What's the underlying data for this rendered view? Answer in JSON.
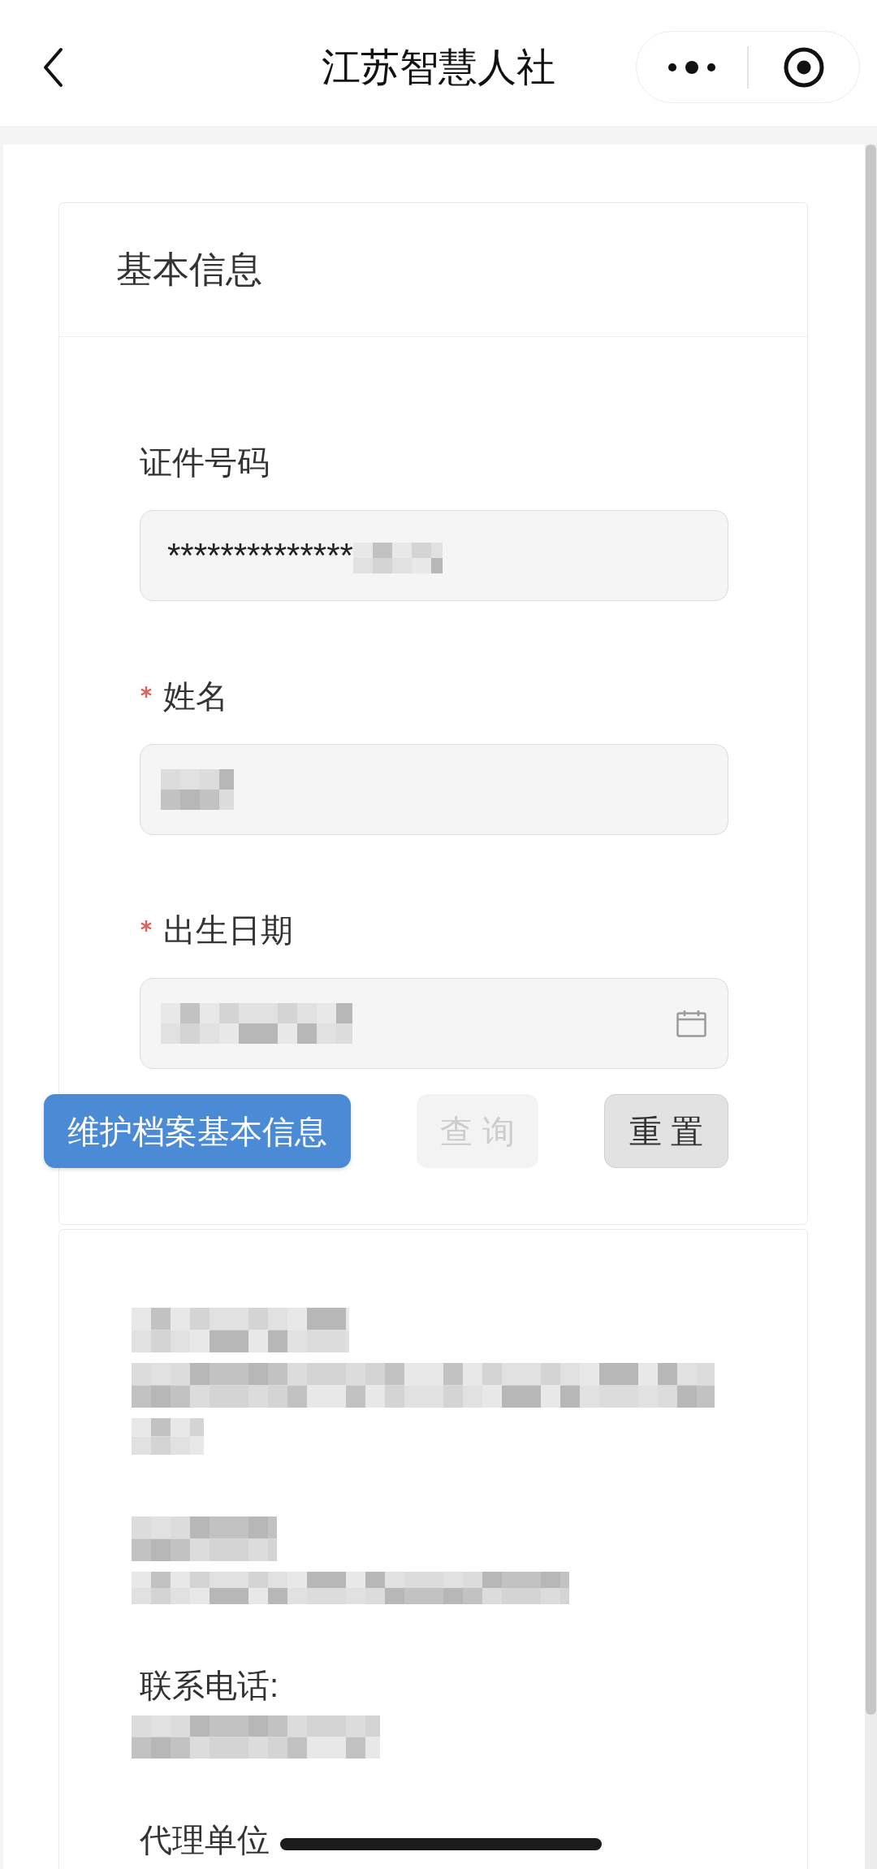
{
  "nav_bar": {
    "title": "江苏智慧人社"
  },
  "form_card": {
    "title": "基本信息",
    "fields": [
      {
        "kind": "text",
        "label": "证件号码",
        "required": false,
        "value": "**************",
        "value_redacted": true
      },
      {
        "kind": "text",
        "label": "姓名",
        "required": true,
        "value_redacted": true
      },
      {
        "kind": "date",
        "label": "出生日期",
        "required": true,
        "value_redacted": true
      }
    ],
    "buttons": [
      {
        "kind": "primary",
        "label": "维护档案基本信息",
        "disabled": false
      },
      {
        "kind": "secondary",
        "label": "查 询",
        "disabled": true
      },
      {
        "kind": "secondary",
        "label": "重 置",
        "disabled": false
      }
    ]
  },
  "details_card": {
    "entries": [
      {
        "lines": [
          {
            "kind": "redacted"
          },
          {
            "kind": "redacted"
          },
          {
            "kind": "redacted"
          }
        ]
      },
      {
        "lines": [
          {
            "kind": "redacted"
          },
          {
            "kind": "redacted"
          }
        ]
      },
      {
        "lines": [
          {
            "kind": "label",
            "label": "联系电话:"
          },
          {
            "kind": "redacted"
          }
        ]
      },
      {
        "lines": [
          {
            "kind": "label",
            "label": "代理单位"
          }
        ]
      }
    ]
  }
}
